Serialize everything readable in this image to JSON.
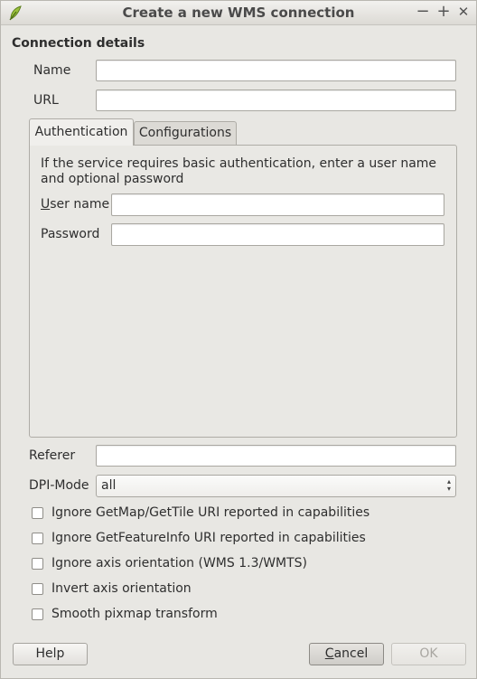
{
  "window": {
    "title": "Create a new WMS connection",
    "controls": {
      "minimize": "−",
      "maximize": "+",
      "close": "✕"
    }
  },
  "connection": {
    "heading": "Connection details",
    "name_label": "Name",
    "name_value": "",
    "url_label": "URL",
    "url_value": ""
  },
  "tabs": [
    {
      "label": "Authentication",
      "active": true
    },
    {
      "label": "Configurations",
      "active": false
    }
  ],
  "authentication": {
    "description": "If the service requires basic authentication, enter a user name and optional password",
    "username_label_mnemonic": "U",
    "username_label_rest": "ser name",
    "username_value": "",
    "password_label": "Password",
    "password_value": ""
  },
  "referer": {
    "label": "Referer",
    "value": ""
  },
  "dpi": {
    "label": "DPI-Mode",
    "selected": "all"
  },
  "checkboxes": [
    {
      "label": "Ignore GetMap/GetTile URI reported in capabilities",
      "checked": false
    },
    {
      "label": "Ignore GetFeatureInfo URI reported in capabilities",
      "checked": false
    },
    {
      "label": "Ignore axis orientation (WMS 1.3/WMTS)",
      "checked": false
    },
    {
      "label": "Invert axis orientation",
      "checked": false
    },
    {
      "label": "Smooth pixmap transform",
      "checked": false
    }
  ],
  "buttons": {
    "help": "Help",
    "cancel_mnemonic": "C",
    "cancel_rest": "ancel",
    "ok": "OK"
  },
  "colors": {
    "window_bg": "#e8e7e3",
    "disabled_text": "#a8a6a1"
  }
}
